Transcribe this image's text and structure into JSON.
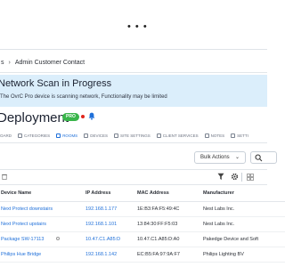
{
  "topbar": {
    "more_icon": "more-dots-icon"
  },
  "breadcrumb": {
    "items": [
      "s",
      "Admin Customer Contact"
    ]
  },
  "banner": {
    "title": "Network Scan in Progress",
    "text": "The OvrC Pro device is scanning network, Functionality may be limited"
  },
  "page": {
    "title": "Deployment",
    "badge": "PRO",
    "status_color": "#e1251b"
  },
  "tabs": [
    {
      "label": "OARD",
      "icon": "dashboard-icon"
    },
    {
      "label": "CATEGORIES",
      "icon": "categories-icon"
    },
    {
      "label": "ROOMS",
      "icon": "rooms-icon",
      "active": true
    },
    {
      "label": "DEVICES",
      "icon": "devices-icon"
    },
    {
      "label": "SITE SETTINGS",
      "icon": "site-settings-icon"
    },
    {
      "label": "CLIENT SERVICES",
      "icon": "client-services-icon"
    },
    {
      "label": "NOTES",
      "icon": "notes-icon"
    },
    {
      "label": "SETTI",
      "icon": "settings-icon"
    }
  ],
  "toolbar": {
    "bulk_actions": "Bulk Actions"
  },
  "table": {
    "headers": [
      "Device Name",
      "IP Address",
      "MAC Address",
      "Manufacturer"
    ],
    "rows": [
      [
        "Next Protect downstairs",
        "192.168.1.177",
        "1E:B3:FA:F5:49:4C",
        "Nest Labs Inc."
      ],
      [
        "Next Protect upstairs",
        "192.168.1.101",
        "13:84:30:FF:F5:03",
        "Nest Labs Inc."
      ],
      [
        "Package SW-17113",
        "10.47.C1.A85:D",
        "10.47.C1.A85:D:A0",
        "Pakedge Device and Soft"
      ],
      [
        "Philips Hue Bridge",
        "192.168.1.142",
        "EC:B5:FA:97:9A:F7",
        "Philips Lighting BV"
      ]
    ]
  },
  "colors": {
    "accent": "#1e6fd9",
    "banner_bg": "#dbeefb",
    "badge": "#39b54a"
  }
}
